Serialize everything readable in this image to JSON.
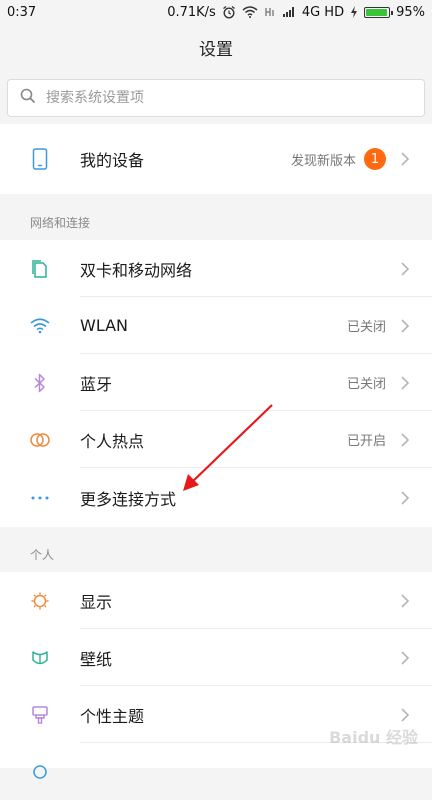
{
  "status_bar": {
    "time": "0:37",
    "network_speed": "0.71K/s",
    "network_type": "4G HD",
    "battery_percent": "95%",
    "battery_level": 0.95
  },
  "header": {
    "title": "设置"
  },
  "search": {
    "placeholder": "搜索系统设置项"
  },
  "my_device": {
    "label": "我的设备",
    "status": "发现新版本",
    "badge": "1"
  },
  "sections": {
    "network": {
      "title": "网络和连接",
      "items": [
        {
          "label": "双卡和移动网络",
          "value": "",
          "icon": "sim-card-icon"
        },
        {
          "label": "WLAN",
          "value": "已关闭",
          "icon": "wifi-icon"
        },
        {
          "label": "蓝牙",
          "value": "已关闭",
          "icon": "bluetooth-icon"
        },
        {
          "label": "个人热点",
          "value": "已开启",
          "icon": "hotspot-icon"
        },
        {
          "label": "更多连接方式",
          "value": "",
          "icon": "more-dots-icon"
        }
      ]
    },
    "personal": {
      "title": "个人",
      "items": [
        {
          "label": "显示",
          "value": "",
          "icon": "display-brightness-icon"
        },
        {
          "label": "壁纸",
          "value": "",
          "icon": "wallpaper-icon"
        },
        {
          "label": "个性主题",
          "value": "",
          "icon": "theme-brush-icon"
        }
      ]
    }
  },
  "colors": {
    "accent_blue": "#3b9ad9",
    "bluetooth_purple": "#b48ad8",
    "orange": "#f08a3c",
    "green": "#2bb39a",
    "badge_orange": "#ff6a10",
    "arrow_red": "#e8191c"
  },
  "watermark": "Baidu 经验"
}
